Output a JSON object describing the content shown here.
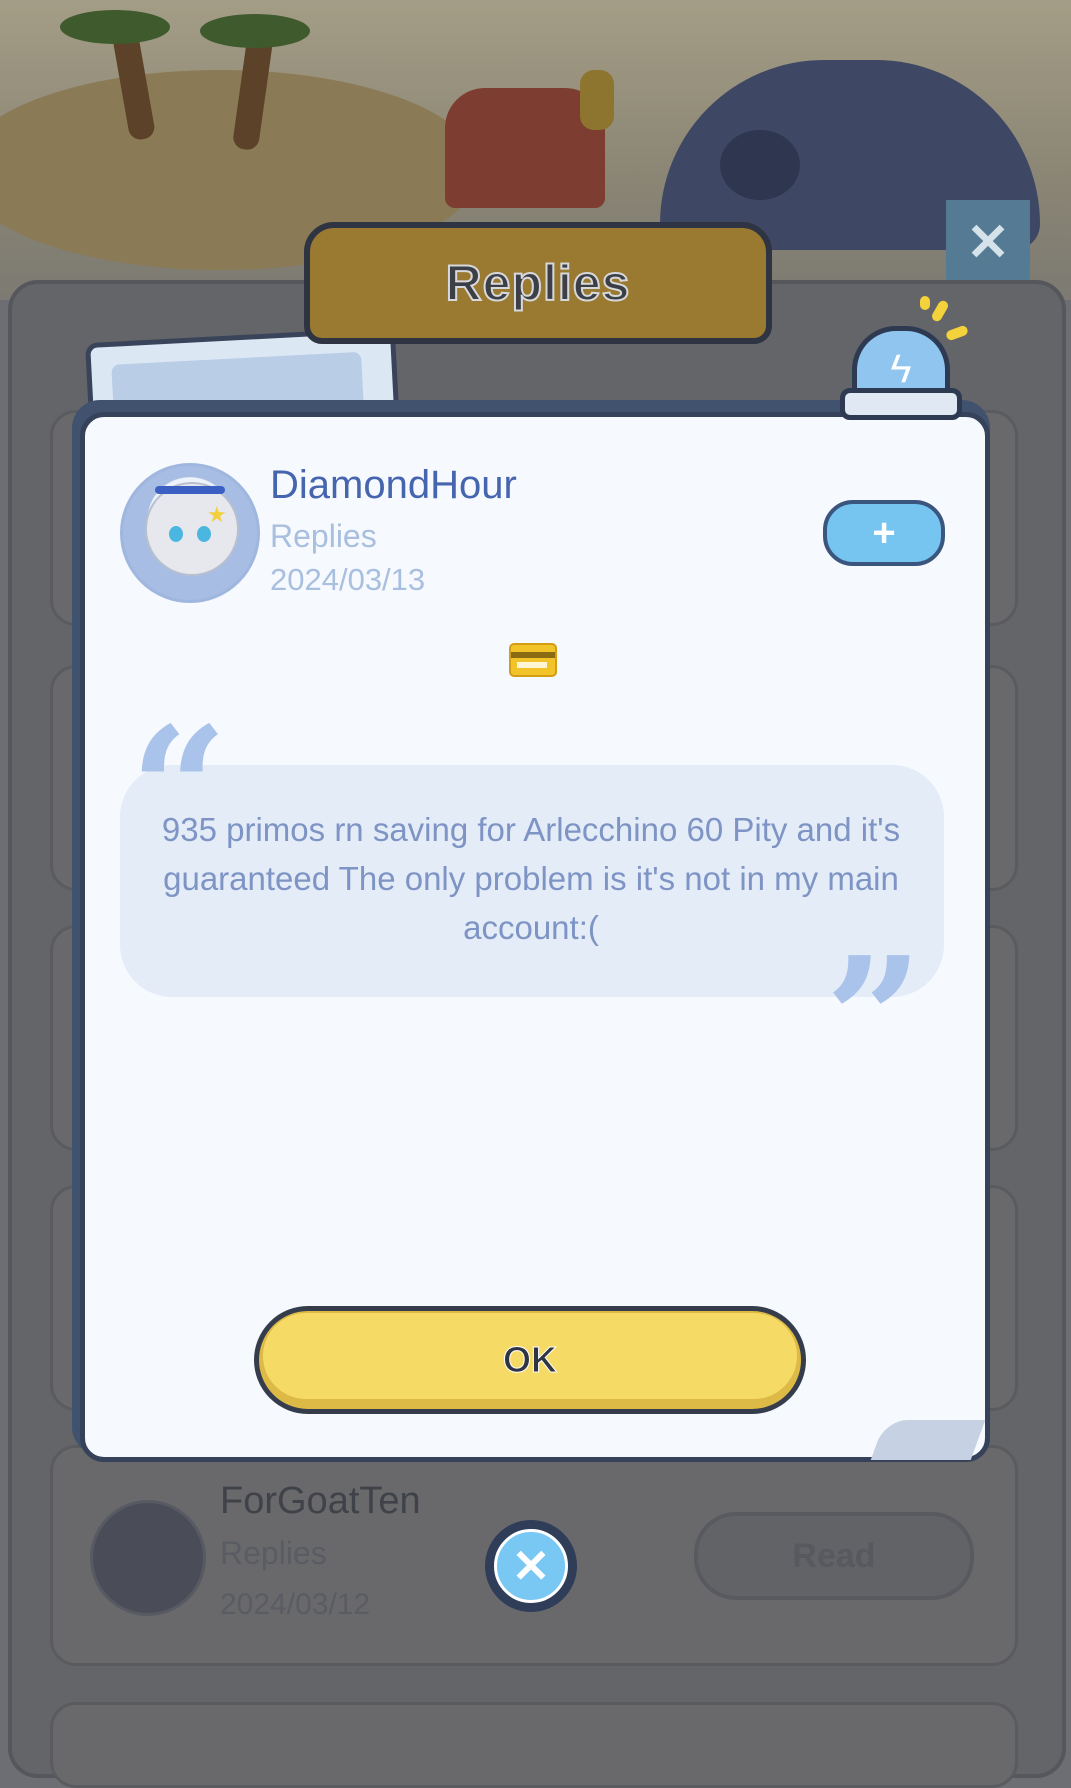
{
  "header": {
    "title": "Replies"
  },
  "scene": {
    "close_icon": "close-icon"
  },
  "modal": {
    "user": {
      "name": "DiamondHour",
      "type": "Replies",
      "date": "2024/03/13"
    },
    "follow_icon": "plus-icon",
    "attachment_icon": "credit-card-icon",
    "quote": "935 primos rn saving for Arlecchino 60 Pity and it's guaranteed The only problem is it's not in my main account:(",
    "ok_label": "OK"
  },
  "underlying_list": {
    "items": [
      {
        "name": "ForGoatTen",
        "type": "Replies",
        "date": "2024/03/12",
        "action": "Read"
      }
    ]
  },
  "close_button": {
    "icon": "close-icon"
  },
  "colors": {
    "accent_blue": "#76c4f0",
    "ok_yellow": "#f6da66",
    "name_blue": "#4565ae",
    "quote_bg": "#e4ecf8"
  }
}
